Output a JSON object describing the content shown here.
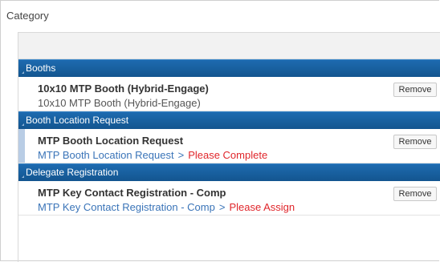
{
  "category_label": "Category",
  "groups": [
    {
      "title": "Booths",
      "item": {
        "name": "10x10 MTP Booth (Hybrid-Engage)",
        "sub": "10x10 MTP Booth (Hybrid-Engage)",
        "remove_label": "Remove"
      }
    },
    {
      "title": "Booth Location Request",
      "item": {
        "name": "MTP Booth Location Request",
        "sub_link": "MTP Booth Location Request",
        "separator": ">",
        "status": "Please Complete",
        "remove_label": "Remove"
      }
    },
    {
      "title": "Delegate Registration",
      "item": {
        "name": "MTP Key Contact Registration - Comp",
        "sub_link": "MTP Key Contact Registration - Comp",
        "separator": ">",
        "status": "Please Assign",
        "remove_label": "Remove"
      }
    }
  ],
  "colors": {
    "header_bg": "#1e6bb0",
    "link": "#3a74b8",
    "warning": "#e0262b",
    "selected_gutter": "#b9cde5"
  },
  "icons": {
    "group_toggle": "collapse-triangle-icon"
  }
}
